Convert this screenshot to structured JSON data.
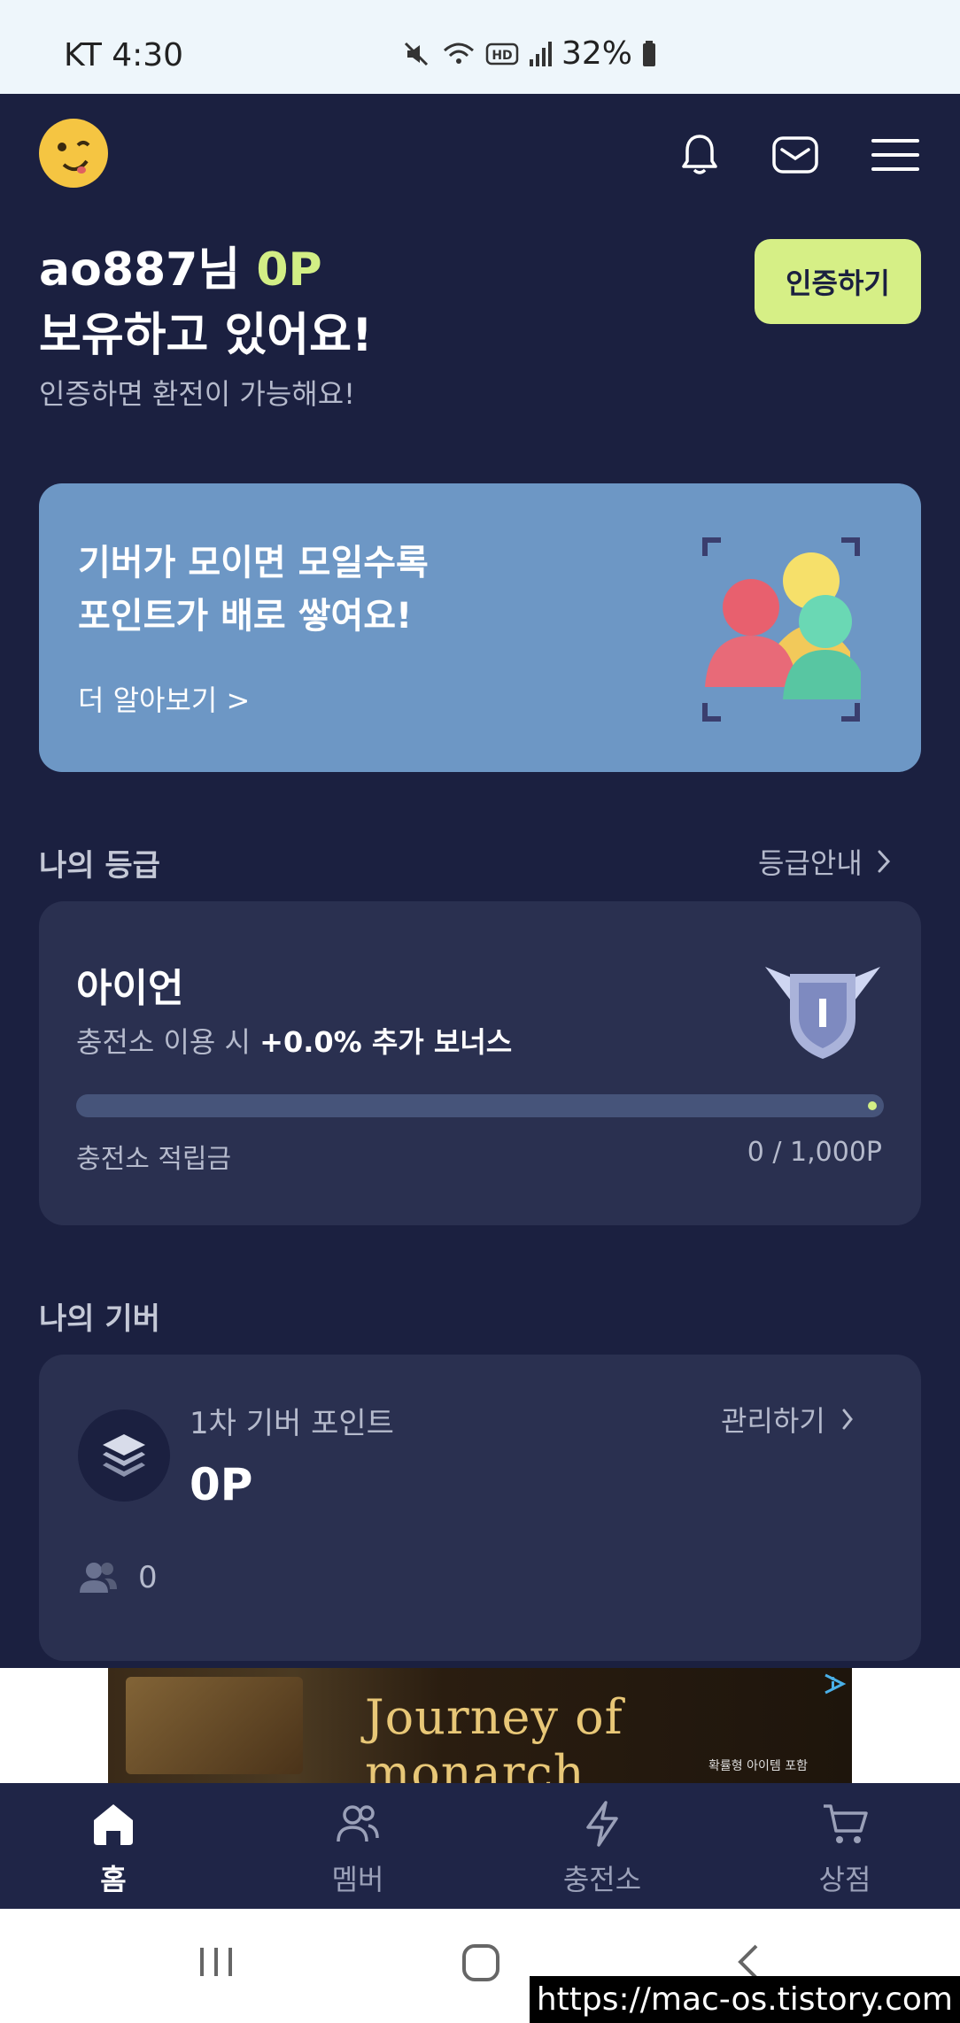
{
  "status_bar": {
    "carrier_time": "KT 4:30",
    "battery": "32%"
  },
  "header": {
    "avatar_icon": "smiley-face-icon"
  },
  "summary": {
    "username": "ao887님",
    "points": "0P",
    "line2": "보유하고 있어요!",
    "subtext": "인증하면 환전이 가능해요!",
    "verify_label": "인증하기"
  },
  "promo": {
    "line1": "기버가 모이면 모일수록",
    "line2": "포인트가 배로 쌓여요!",
    "more": "더 알아보기 >"
  },
  "grade": {
    "section_title": "나의 등급",
    "guide_label": "등급안내",
    "name": "아이언",
    "desc_prefix": "충전소 이용 시 ",
    "bonus": "+0.0% 추가 보너스",
    "accum_label": "충전소 적립금",
    "accum_value": "0 / 1,000P",
    "progress_fraction": 0.0
  },
  "giver": {
    "section_title": "나의 기버",
    "label": "1차 기버 포인트",
    "points": "0P",
    "manage_label": "관리하기",
    "member_count": "0"
  },
  "ad": {
    "title": "Journey of monarch",
    "sub": "확률형 아이템 포함"
  },
  "bottom_nav": {
    "items": [
      {
        "label": "홈",
        "icon": "home-icon",
        "active": true
      },
      {
        "label": "멤버",
        "icon": "members-icon",
        "active": false
      },
      {
        "label": "충전소",
        "icon": "lightning-icon",
        "active": false
      },
      {
        "label": "상점",
        "icon": "cart-icon",
        "active": false
      }
    ]
  },
  "watermark": "https://mac-os.tistory.com",
  "colors": {
    "background": "#1b2040",
    "card": "#2a3050",
    "accent": "#d2ee85",
    "promo": "#6d97c5"
  }
}
